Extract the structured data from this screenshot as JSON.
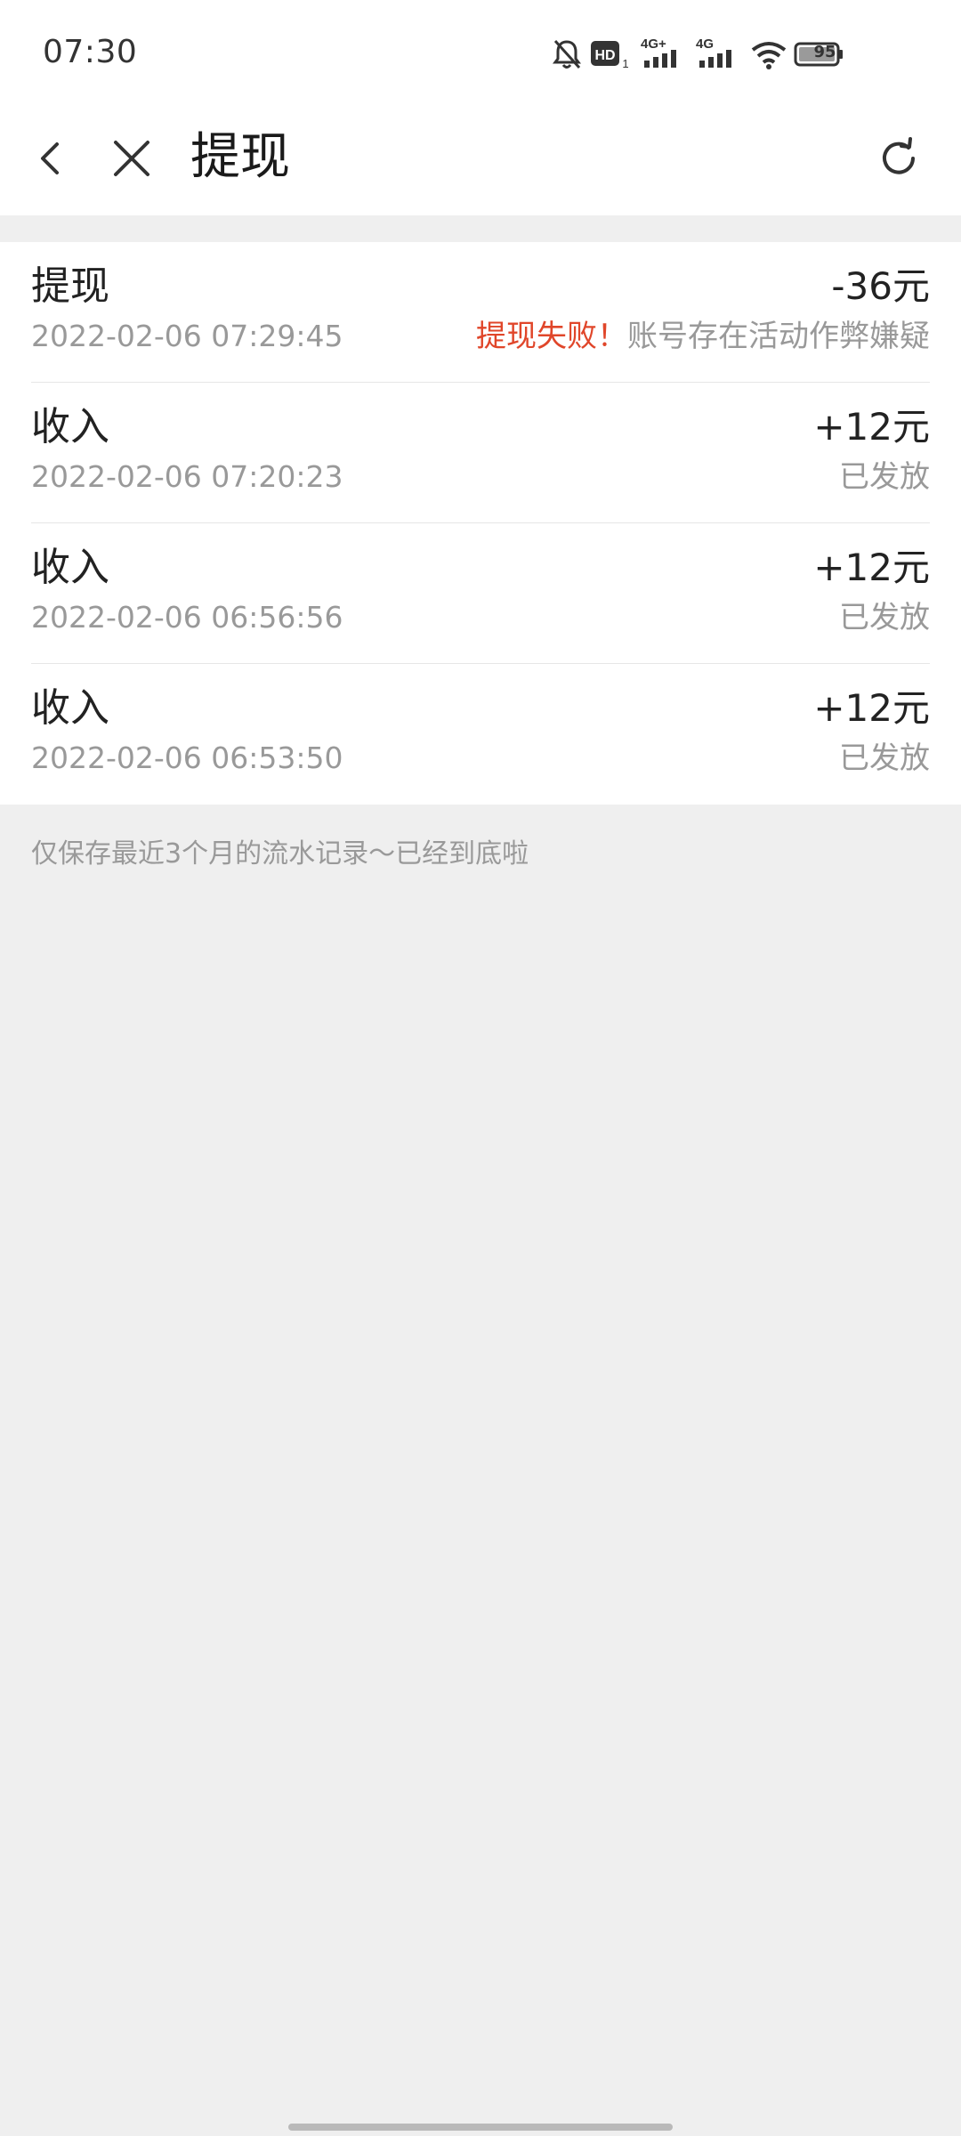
{
  "status_bar": {
    "time": "07:30",
    "battery": "95",
    "icons": [
      "mute-bell-icon",
      "hd-icon",
      "4g-plus-signal-icon",
      "4g-signal-icon",
      "wifi-icon",
      "battery-icon"
    ]
  },
  "header": {
    "title": "提现",
    "icons": [
      "back-icon",
      "close-icon",
      "refresh-icon"
    ]
  },
  "records": [
    {
      "title": "提现",
      "time": "2022-02-06 07:29:45",
      "amount": "-36元",
      "status_highlight": "提现失败！",
      "status": "账号存在活动作弊嫌疑"
    },
    {
      "title": "收入",
      "time": "2022-02-06 07:20:23",
      "amount": "+12元",
      "status_highlight": "",
      "status": "已发放"
    },
    {
      "title": "收入",
      "time": "2022-02-06 06:56:56",
      "amount": "+12元",
      "status_highlight": "",
      "status": "已发放"
    },
    {
      "title": "收入",
      "time": "2022-02-06 06:53:50",
      "amount": "+12元",
      "status_highlight": "",
      "status": "已发放"
    }
  ],
  "footer_note": "仅保存最近3个月的流水记录～已经到底啦",
  "colors": {
    "fail_red": "#e0462a",
    "text_dark": "#222222",
    "text_gray": "#999999",
    "page_bg": "#efefef"
  }
}
